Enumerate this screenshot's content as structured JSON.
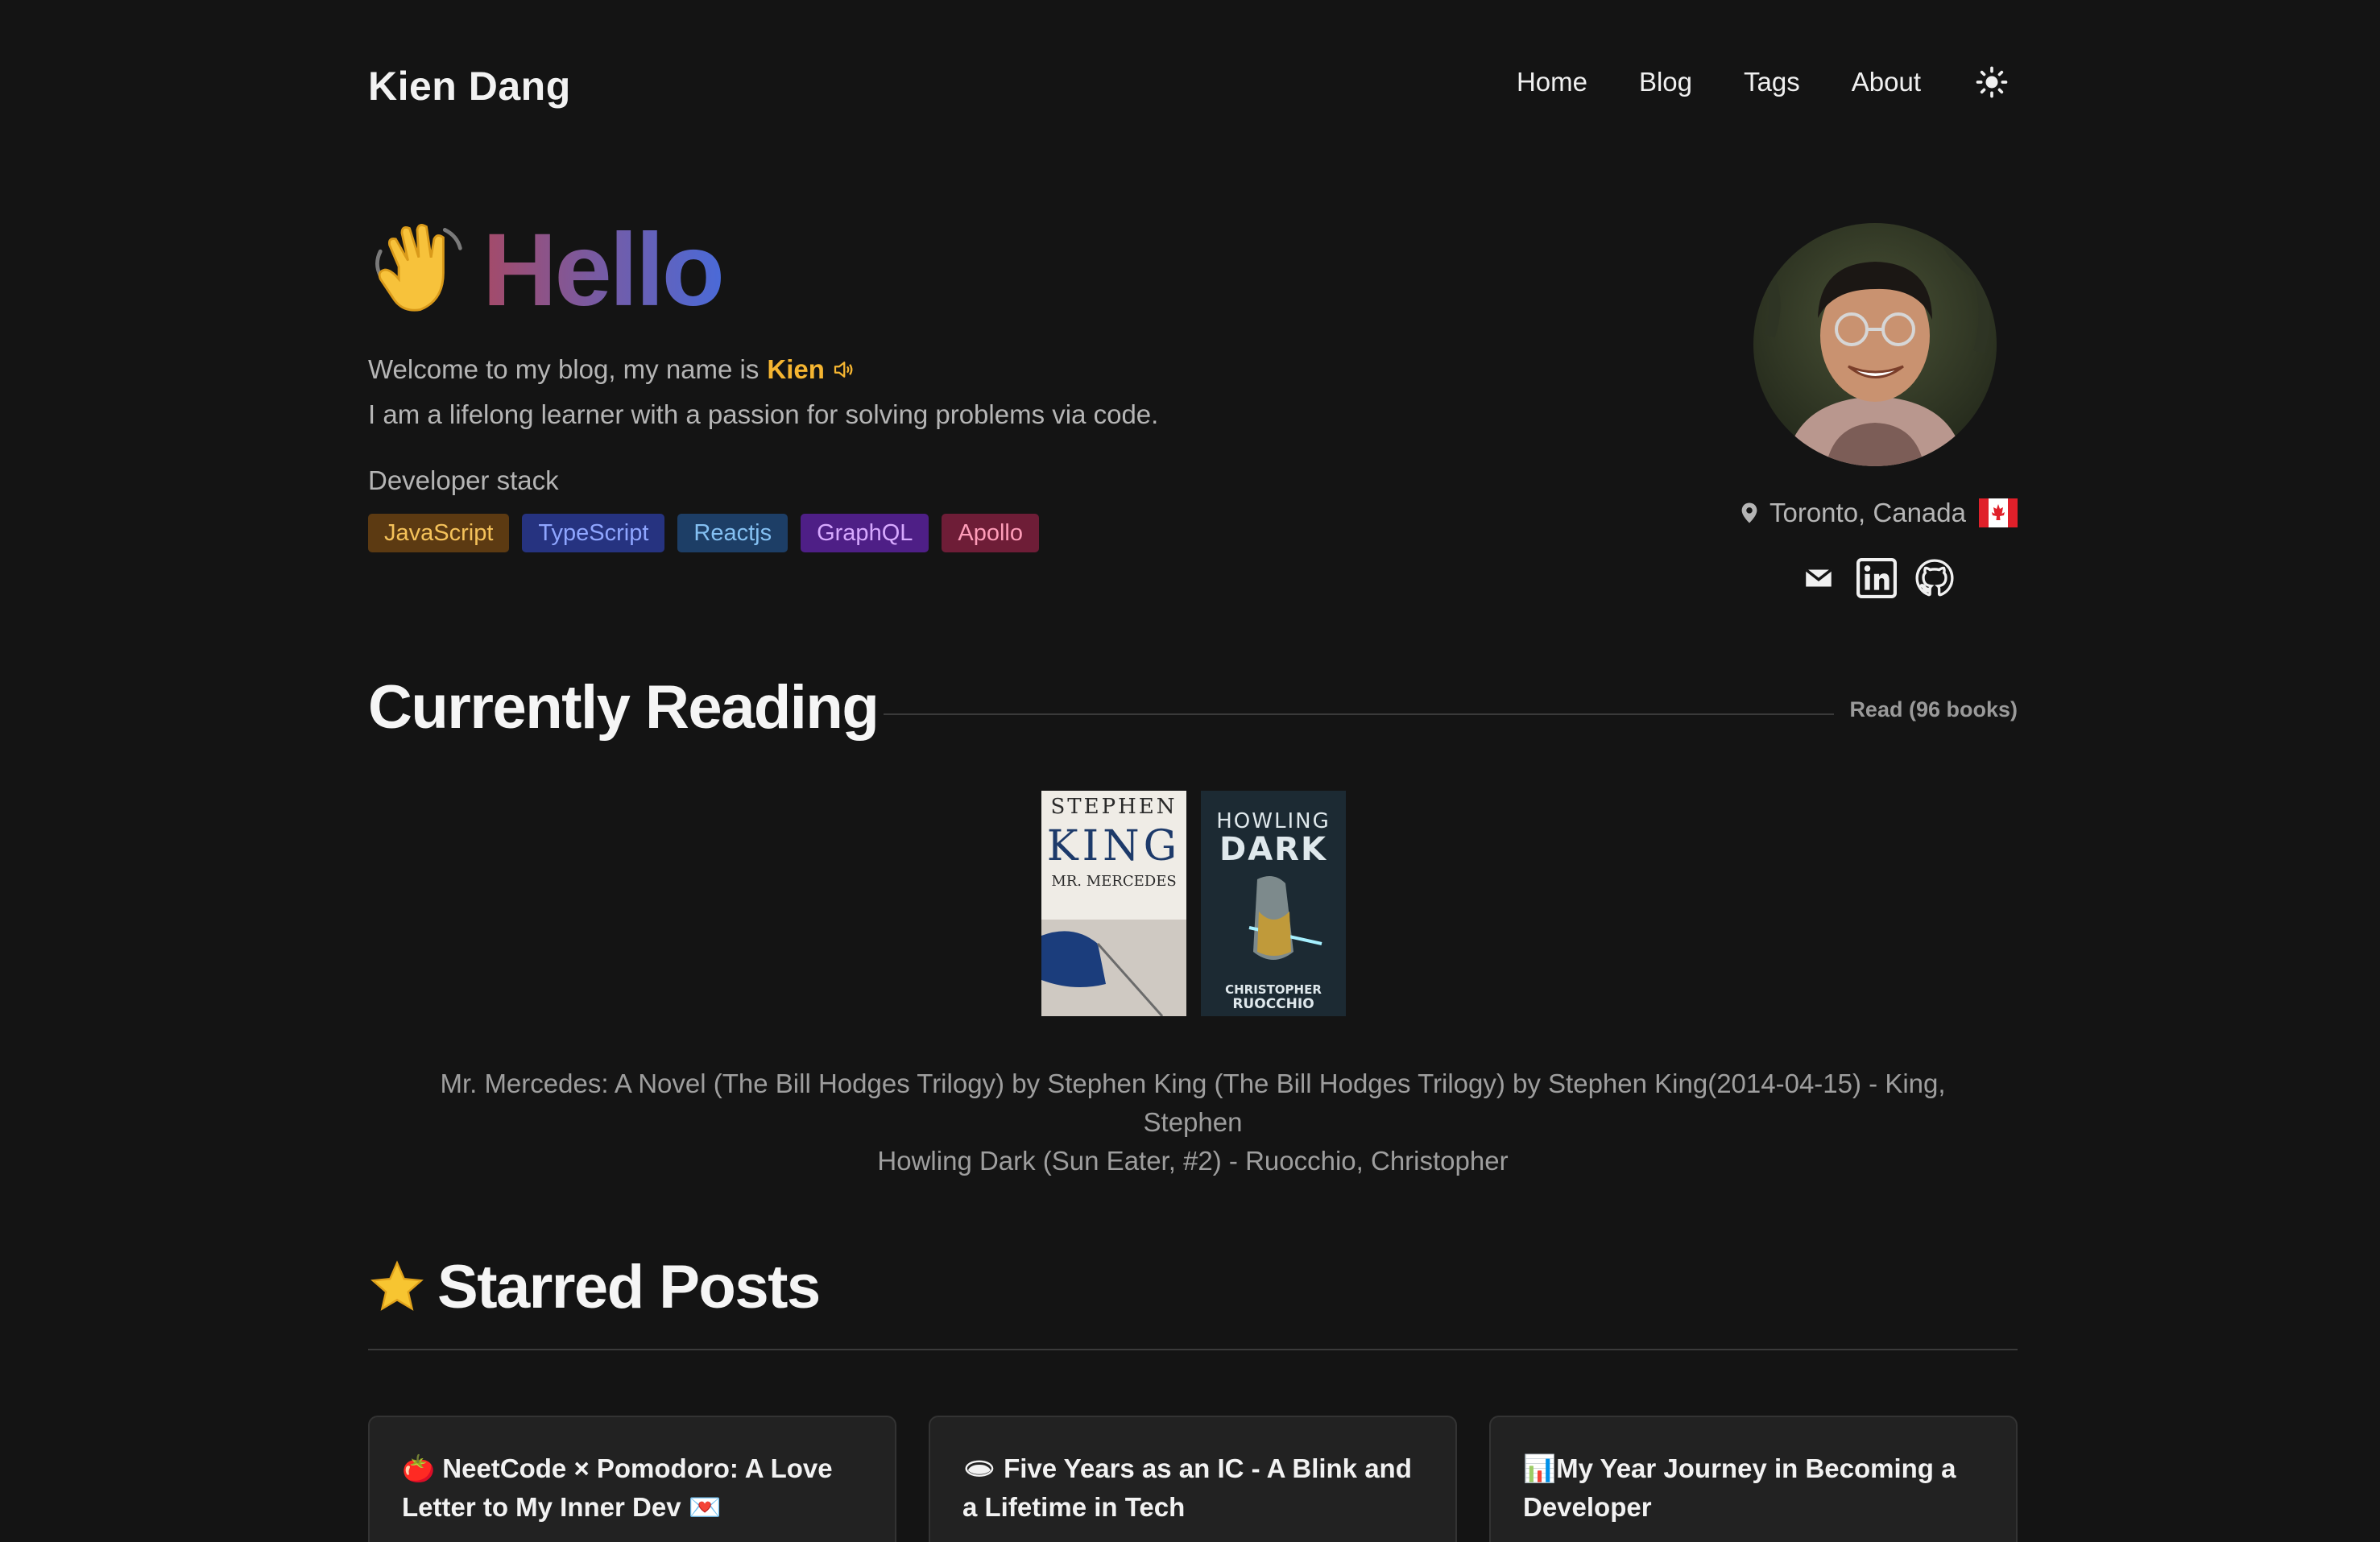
{
  "header": {
    "site_title": "Kien Dang",
    "nav": [
      "Home",
      "Blog",
      "Tags",
      "About"
    ],
    "theme_icon": "sun-icon"
  },
  "hero": {
    "heading": "Hello",
    "intro_prefix": "Welcome to my blog, my name is",
    "name": "Kien",
    "intro_line2": "I am a lifelong learner with a passion for solving problems via code.",
    "stack_label": "Developer stack",
    "stack": [
      {
        "label": "JavaScript",
        "bg": "#5c3a12",
        "fg": "#f5c25a"
      },
      {
        "label": "TypeScript",
        "bg": "#263380",
        "fg": "#8fa6ff"
      },
      {
        "label": "Reactjs",
        "bg": "#1d3e66",
        "fg": "#84c0f2"
      },
      {
        "label": "GraphQL",
        "bg": "#4e1f86",
        "fg": "#d7a9ff"
      },
      {
        "label": "Apollo",
        "bg": "#6e1d37",
        "fg": "#ff9db9"
      }
    ]
  },
  "profile": {
    "location": "Toronto, Canada",
    "socials": [
      "mail-icon",
      "linkedin-icon",
      "github-icon"
    ]
  },
  "reading": {
    "title": "Currently Reading",
    "count_label": "Read (96 books)",
    "books": [
      {
        "cover_author": "STEPHEN",
        "cover_author2": "KING",
        "cover_title": "MR. MERCEDES",
        "full_title": "Mr. Mercedes: A Novel (The Bill Hodges Trilogy) by Stephen King (The Bill Hodges Trilogy) by Stephen King(2014-04-15) - King, Stephen"
      },
      {
        "cover_title1": "HOWLING",
        "cover_title2": "DARK",
        "cover_author1": "CHRISTOPHER",
        "cover_author2": "RUOCCHIO",
        "full_title": "Howling Dark (Sun Eater, #2) - Ruocchio, Christopher"
      }
    ]
  },
  "starred": {
    "title": "Starred Posts",
    "posts": [
      "🍅 NeetCode × Pomodoro: A Love Letter to My Inner Dev 💌",
      "🕳 Five Years as an IC - A Blink and a Lifetime in Tech",
      "📊My Year Journey in Becoming a Developer"
    ]
  }
}
